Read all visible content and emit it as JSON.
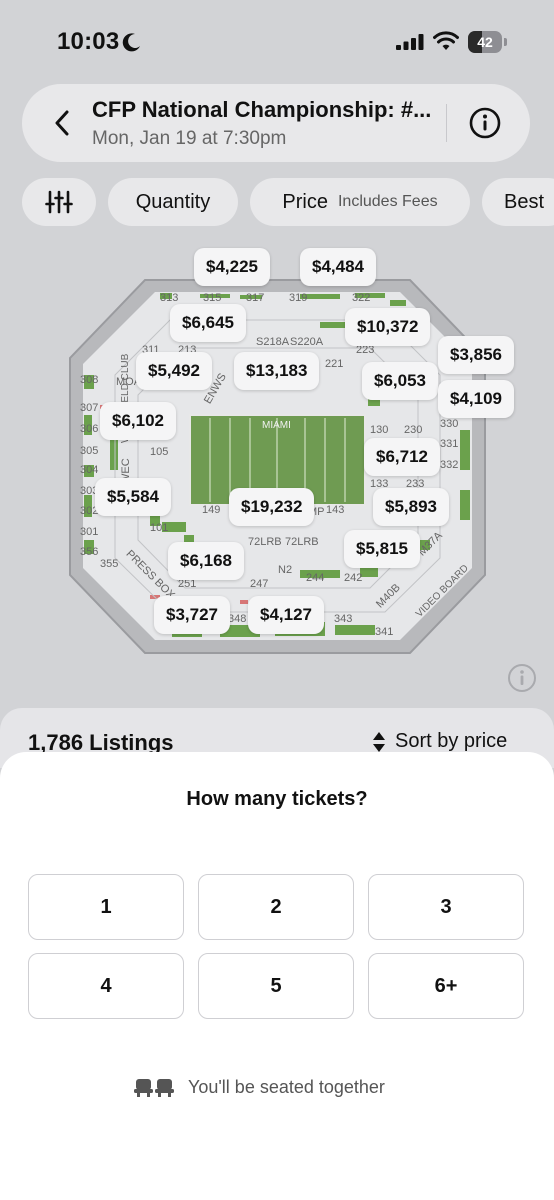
{
  "status": {
    "time": "10:03",
    "battery": "42",
    "battery_level": 0.42
  },
  "header": {
    "title": "CFP National Championship: #...",
    "subtitle": "Mon, Jan 19 at 7:30pm",
    "icons": {
      "back": "chevron-left-icon",
      "info": "info-icon"
    }
  },
  "filters": {
    "quantity_label": "Quantity",
    "price_label": "Price",
    "price_sub": "Includes Fees",
    "best_label": "Best"
  },
  "map": {
    "field_label": "MIAMI",
    "club_label": "WEST FIELD CLUB",
    "prices": [
      "$4,225",
      "$4,484",
      "$6,645",
      "$10,372",
      "$3,856",
      "$5,492",
      "$13,183",
      "$6,053",
      "$4,109",
      "$6,102",
      "$6,712",
      "$5,584",
      "$19,232",
      "$5,893",
      "$5,815",
      "$6,168",
      "$3,727",
      "$4,127"
    ],
    "sections": [
      "313",
      "315",
      "317",
      "319",
      "322",
      "213",
      "S218A",
      "S220A",
      "223",
      "311",
      "MOA",
      "308",
      "307",
      "306",
      "305",
      "304",
      "303",
      "302",
      "301",
      "356",
      "355",
      "221",
      "330",
      "331",
      "332",
      "130",
      "230",
      "233",
      "133",
      "143",
      "149",
      "101",
      "105",
      "72LRB",
      "72LRB",
      "N2",
      "244",
      "242",
      "247",
      "251",
      "348",
      "343",
      "341",
      "M37A",
      "M40B",
      "PRESS BOX",
      "VIDEO BOARD",
      "WEC",
      "ENWS",
      "MP"
    ]
  },
  "listings": {
    "count_text": "1,786 Listings",
    "sort_label": "Sort by price"
  },
  "sheet": {
    "title": "How many tickets?",
    "options": [
      "1",
      "2",
      "3",
      "4",
      "5",
      "6+"
    ],
    "seated_together": "You'll be seated together"
  },
  "colors": {
    "background": "#d2d3d6",
    "card": "#e8e8ea",
    "sheet": "#ffffff",
    "field": "#6f9b52",
    "seat_green": "#5e9a3c"
  }
}
